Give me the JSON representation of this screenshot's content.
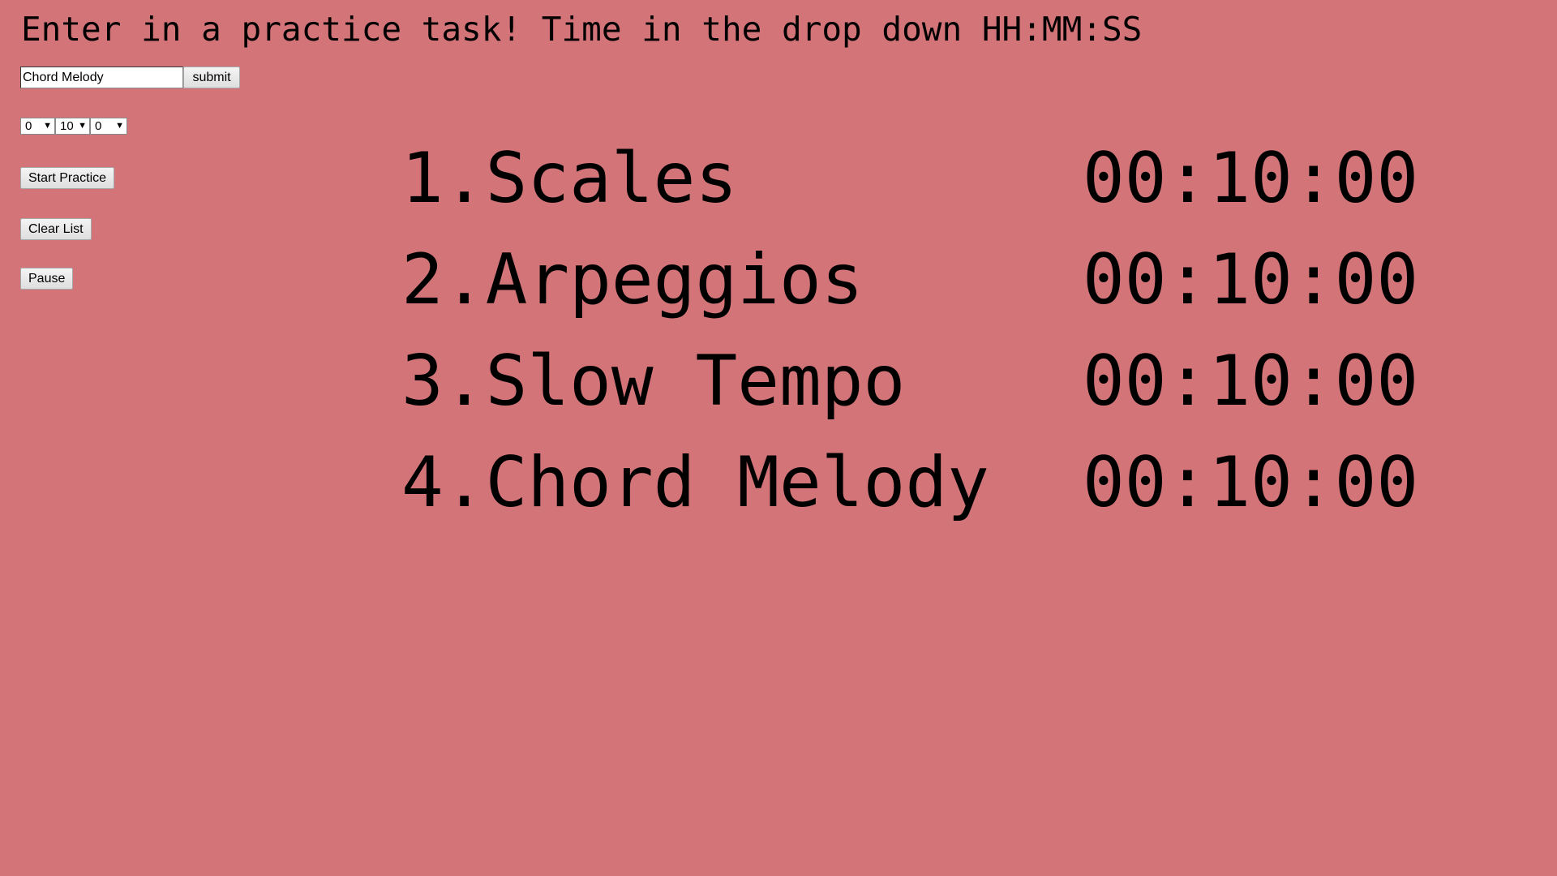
{
  "heading": "Enter in a practice task! Time in the drop down HH:MM:SS",
  "task_input": {
    "value": "Chord Melody"
  },
  "buttons": {
    "submit": "submit",
    "start_practice": "Start Practice",
    "clear_list": "Clear List",
    "pause": "Pause"
  },
  "time_selects": {
    "hours": "0",
    "minutes": "10",
    "seconds": "0",
    "arrow_icon": "▼"
  },
  "practice_list": [
    {
      "number": "1.",
      "name": "Scales",
      "time": "00:10:00"
    },
    {
      "number": "2.",
      "name": "Arpeggios",
      "time": "00:10:00"
    },
    {
      "number": "3.",
      "name": "Slow Tempo",
      "time": "00:10:00"
    },
    {
      "number": "4.",
      "name": "Chord Melody",
      "time": "00:10:00"
    }
  ],
  "colors": {
    "background": "#d37479",
    "text": "#000000"
  }
}
